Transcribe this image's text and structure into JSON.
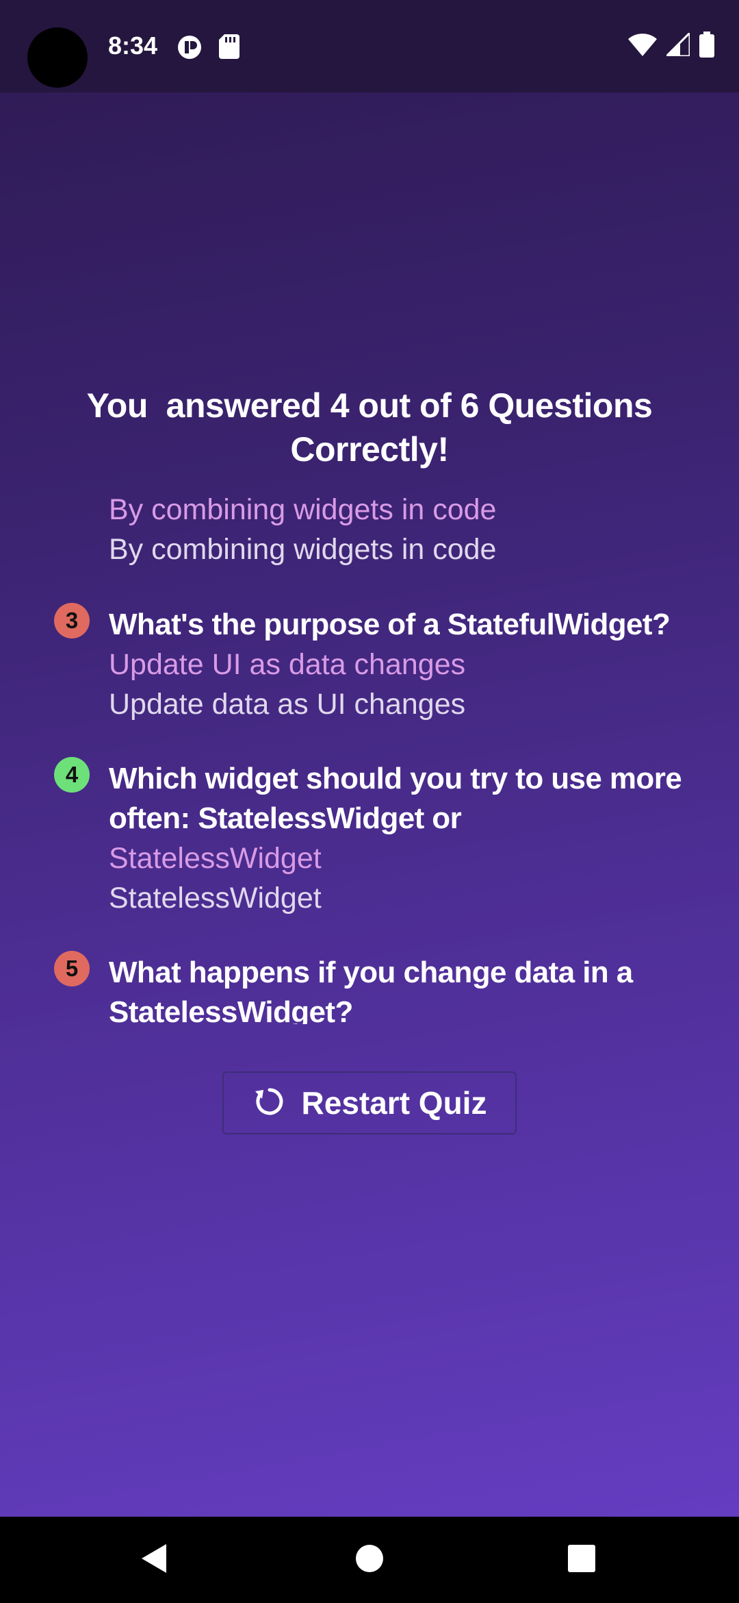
{
  "status_bar": {
    "time": "8:34",
    "icons_left": [
      "app-notification-icon",
      "sd-card-icon"
    ],
    "icons_right": [
      "wifi-icon",
      "cellular-signal-icon",
      "battery-icon"
    ]
  },
  "summary": {
    "title": "You  answered 4 out of 6 Questions Correctly!",
    "items": [
      {
        "user_answer": "By combining widgets in code",
        "correct_answer": "By combining widgets in code"
      },
      {
        "number": "3",
        "status_color": "#e06a5f",
        "question": "What's the purpose of a StatefulWidget?",
        "user_answer": "Update UI as data changes",
        "correct_answer": "Update data as UI changes"
      },
      {
        "number": "4",
        "status_color": "#6ee07a",
        "question": "Which widget should you try to use more often: StatelessWidget or",
        "user_answer": "StatelessWidget",
        "correct_answer": "StatelessWidget"
      },
      {
        "number": "5",
        "status_color": "#e06a5f",
        "question": "What happens if you change data in a StatelessWidget?"
      }
    ]
  },
  "restart_button": {
    "label": "Restart Quiz",
    "icon": "restart-icon"
  },
  "nav_bar": {
    "buttons": [
      "back-icon",
      "home-icon",
      "recents-icon"
    ]
  },
  "colors": {
    "user_answer": "#d99be6",
    "correct_answer": "#e0d8ee",
    "wrong_badge": "#e06a5f",
    "right_badge": "#6ee07a"
  }
}
